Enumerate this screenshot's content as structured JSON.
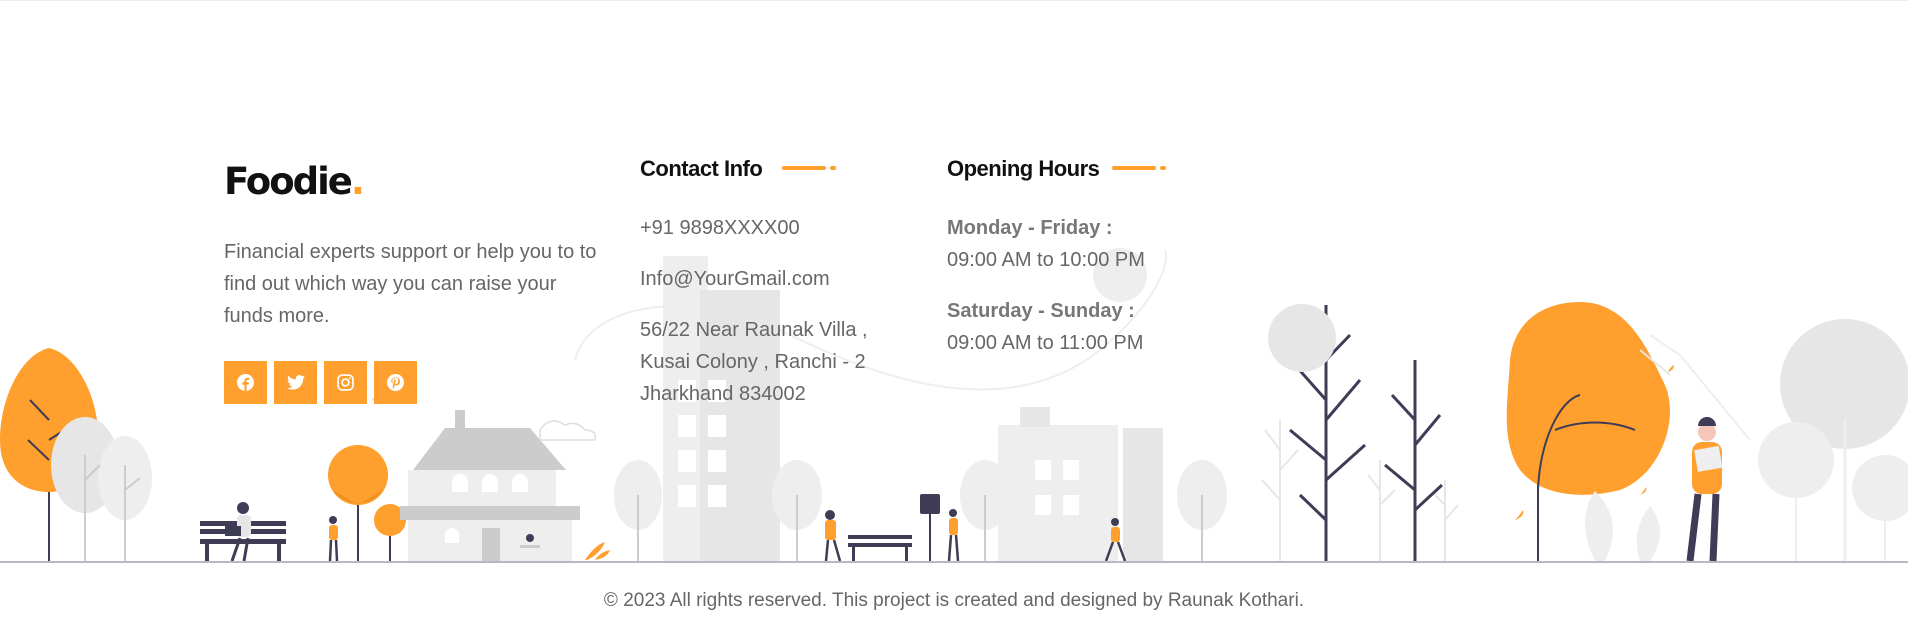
{
  "brand": {
    "name": "Foodie",
    "dot": "."
  },
  "about": {
    "description": "Financial experts support or help you to to find out which way you can raise your funds more."
  },
  "social": [
    {
      "icon": "facebook-icon"
    },
    {
      "icon": "twitter-icon"
    },
    {
      "icon": "instagram-icon"
    },
    {
      "icon": "pinterest-icon"
    }
  ],
  "contact": {
    "title": "Contact Info",
    "phone": "+91 9898XXXX00",
    "email": "Info@YourGmail.com",
    "address_line1": "56/22 Near Raunak Villa ,",
    "address_line2": "Kusai Colony , Ranchi - 2",
    "address_line3": "Jharkhand 834002"
  },
  "hours": {
    "title": "Opening Hours",
    "weekday_label": "Monday - Friday :",
    "weekday_time": "09:00 AM to 10:00 PM",
    "weekend_label": "Saturday - Sunday :",
    "weekend_time": "09:00 AM to 11:00 PM"
  },
  "footer": {
    "copyright": "© 2023 All rights reserved. This project is created and designed by Raunak Kothari."
  },
  "colors": {
    "accent": "#ff9f2e",
    "text": "#666666",
    "heading": "#111111",
    "illustration_gray": "#e6e6e6",
    "dark": "#3f3d56"
  }
}
